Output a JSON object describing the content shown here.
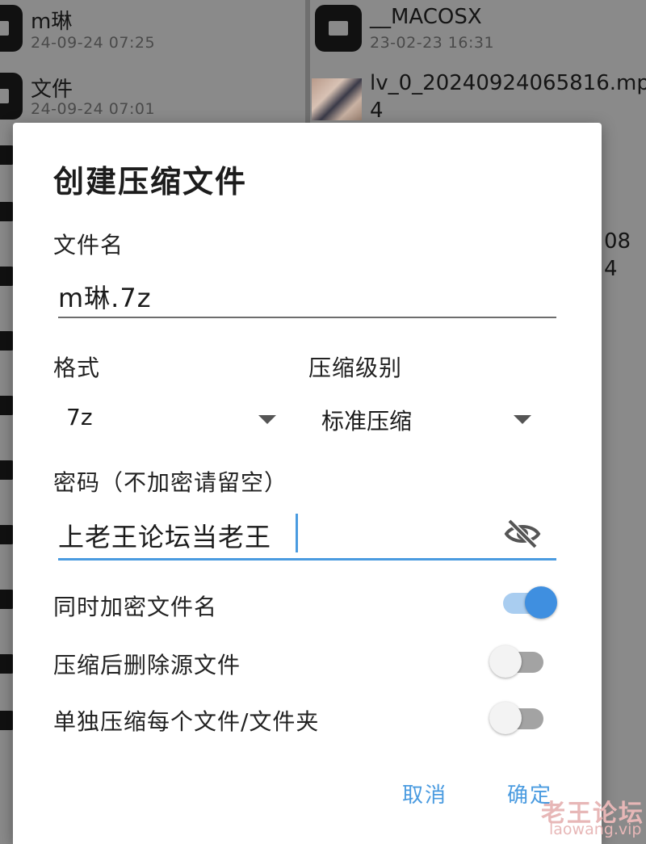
{
  "background": {
    "left_files": [
      {
        "name": "m琳",
        "date": "24-09-24 07:25"
      },
      {
        "name": "文件",
        "date": "24-09-24 07:01"
      }
    ],
    "right_files": [
      {
        "name": "__MACOSX",
        "date": "23-02-23 16:31"
      },
      {
        "name_line1": "lv_0_20240924065816.mp",
        "name_line2": "4"
      }
    ],
    "partial_text_1": "08",
    "partial_text_2": "4"
  },
  "dialog": {
    "title": "创建压缩文件",
    "filename_label": "文件名",
    "filename_value": "m琳.7z",
    "format_label": "格式",
    "format_value": "7z",
    "level_label": "压缩级别",
    "level_value": "标准压缩",
    "password_label": "密码（不加密请留空）",
    "password_value": "上老王论坛当老王",
    "option_encrypt_names": {
      "label": "同时加密文件名",
      "enabled": true
    },
    "option_delete_source": {
      "label": "压缩后删除源文件",
      "enabled": false
    },
    "option_separate": {
      "label": "单独压缩每个文件/文件夹",
      "enabled": false
    },
    "cancel_label": "取消",
    "ok_label": "确定",
    "accent_color": "#4a9be0"
  },
  "watermark": {
    "line1": "老王论坛",
    "line2": "laowang.vip"
  }
}
